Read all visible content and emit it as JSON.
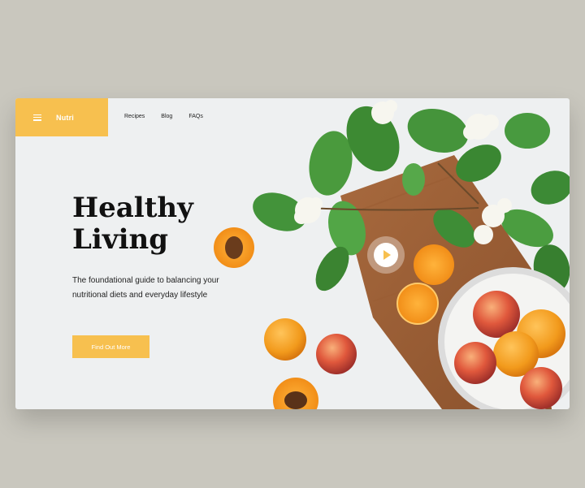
{
  "brand": {
    "name": "Nutri"
  },
  "nav": {
    "items": [
      "Recipes",
      "Blog",
      "FAQs"
    ]
  },
  "hero": {
    "title_line1": "Healthy",
    "title_line2": "Living",
    "description": "The foundational guide to balancing your nutritional diets and everyday lifestyle",
    "cta_label": "Find Out More"
  },
  "colors": {
    "accent": "#f7c04f",
    "background": "#eef0f1",
    "outer": "#c9c7be"
  },
  "icons": {
    "menu": "hamburger-menu-icon",
    "play": "play-icon"
  }
}
